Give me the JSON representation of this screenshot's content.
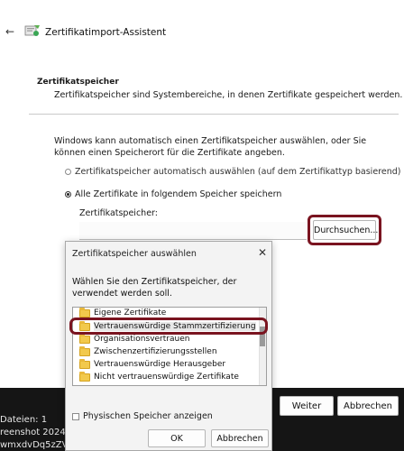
{
  "wizard": {
    "title": "Zertifikatimport-Assistent",
    "section_title": "Zertifikatspeicher",
    "section_description": "Zertifikatspeicher sind Systembereiche, in denen Zertifikate gespeichert werden.",
    "intro": "Windows kann automatisch einen Zertifikatspeicher auswählen, oder Sie können einen Speicherort für die Zertifikate angeben.",
    "radio_auto": "Zertifikatspeicher automatisch auswählen (auf dem Zertifikattyp basierend)",
    "radio_manual": "Alle Zertifikate in folgendem Speicher speichern",
    "store_label": "Zertifikatspeicher:",
    "store_value": "",
    "browse_label": "Durchsuchen...",
    "next_label": "Weiter",
    "cancel_label": "Abbrechen"
  },
  "overlay_text": {
    "line1": "Dateien: 1",
    "line2": "reenshot 2024-",
    "line3": "wmxdvDq5zZV"
  },
  "dialog": {
    "title": "Zertifikatspeicher auswählen",
    "description": "Wählen Sie den Zertifikatspeicher, der verwendet werden soll.",
    "tree_items": [
      "Eigene Zertifikate",
      "Vertrauenswürdige Stammzertifizierung",
      "Organisationsvertrauen",
      "Zwischenzertifizierungsstellen",
      "Vertrauenswürdige Herausgeber",
      "Nicht vertrauenswürdige Zertifikate"
    ],
    "checkbox_label": "Physischen Speicher anzeigen",
    "ok_label": "OK",
    "cancel_label": "Abbrechen"
  },
  "colors": {
    "highlight": "#7a1420",
    "folder": "#f2c94c"
  }
}
